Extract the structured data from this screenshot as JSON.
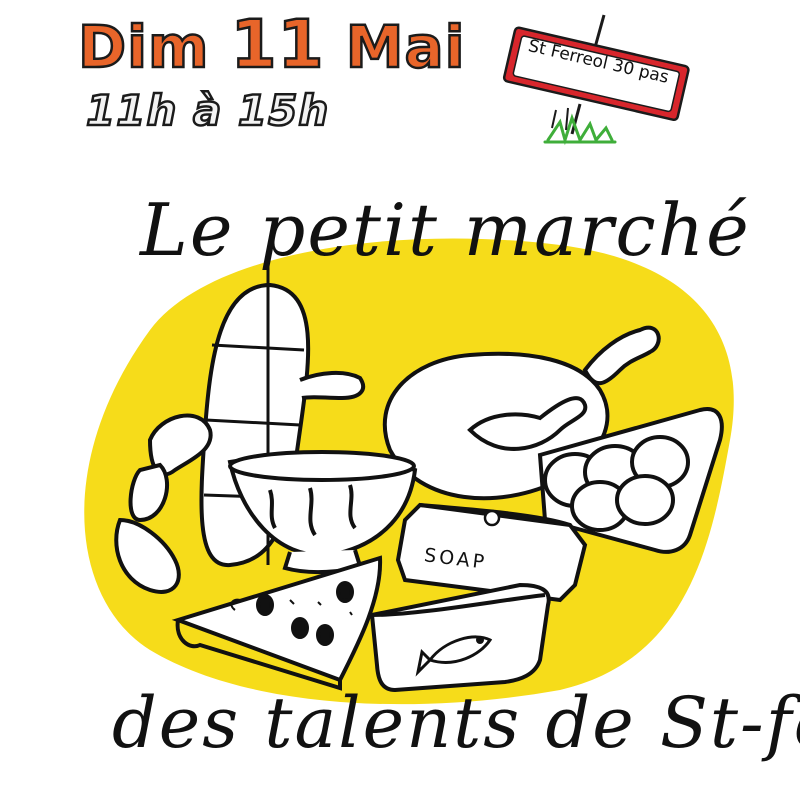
{
  "poster": {
    "date_day": "Dim",
    "date_number": "11",
    "date_month": "Mai",
    "hours": "11h à 15h",
    "sign": "St Ferreol 30 pas",
    "title_line1": "Le petit marché",
    "title_line2": "des talents de St-fé",
    "soap_label": "SOAP"
  },
  "colors": {
    "date_orange": "#e8652a",
    "blob_yellow": "#f6dc1a",
    "sign_red": "#d8262c",
    "grass_green": "#3fae3a",
    "ink": "#1b1b1b"
  },
  "illustrations": [
    "yellow-blob",
    "signpost",
    "grass",
    "salami",
    "sausages",
    "bowl",
    "chicken-leg",
    "egg-carton",
    "soap-bar",
    "pizza-slice",
    "pie-dish",
    "fish"
  ]
}
